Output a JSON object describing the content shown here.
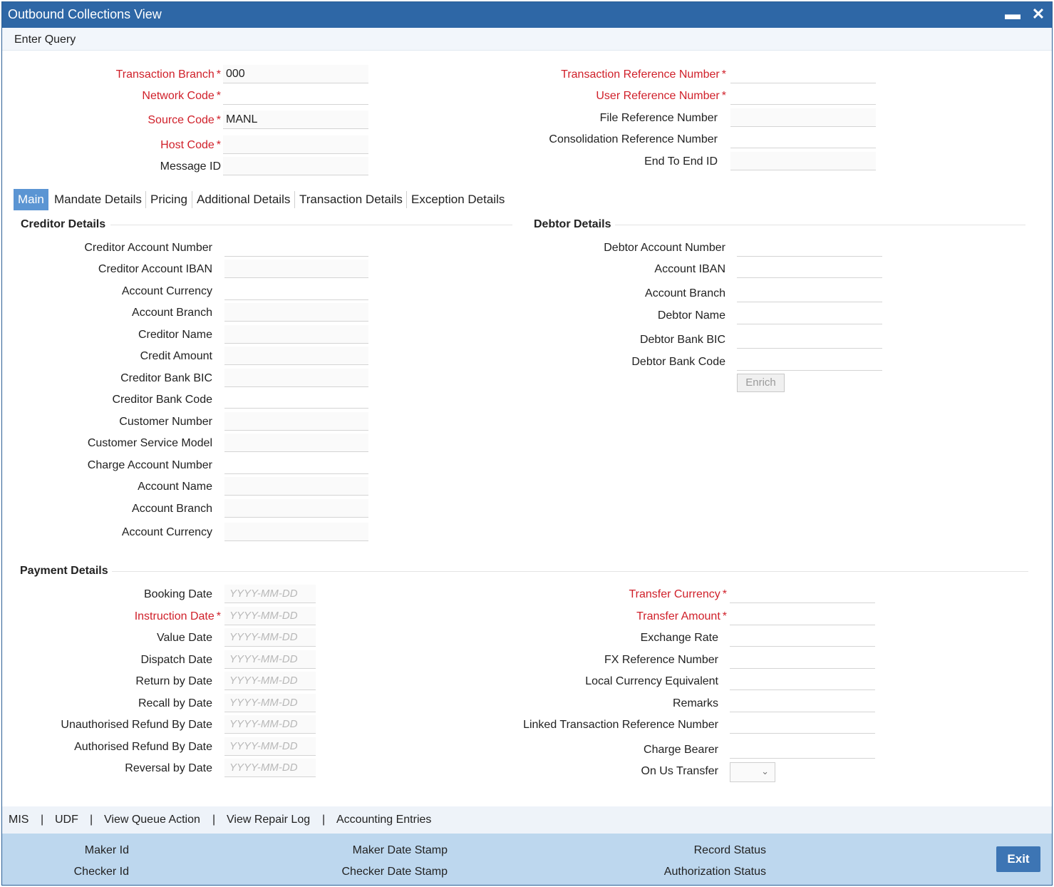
{
  "window": {
    "title": "Outbound Collections View"
  },
  "menu": {
    "enter_query": "Enter Query"
  },
  "header": {
    "transaction_branch": {
      "label": "Transaction Branch",
      "value": "000"
    },
    "network_code": {
      "label": "Network Code",
      "value": ""
    },
    "source_code": {
      "label": "Source Code",
      "value": "MANL"
    },
    "host_code": {
      "label": "Host Code",
      "value": ""
    },
    "message_id": {
      "label": "Message ID",
      "value": ""
    },
    "transaction_reference_number": {
      "label": "Transaction Reference Number",
      "value": ""
    },
    "user_reference_number": {
      "label": "User Reference Number",
      "value": ""
    },
    "file_reference_number": {
      "label": "File Reference Number",
      "value": ""
    },
    "consolidation_reference_number": {
      "label": "Consolidation Reference Number",
      "value": ""
    },
    "end_to_end_id": {
      "label": "End To End ID",
      "value": ""
    }
  },
  "tabs": [
    "Main",
    "Mandate Details",
    "Pricing",
    "Additional Details",
    "Transaction Details",
    "Exception Details"
  ],
  "creditor": {
    "title": "Creditor Details",
    "fields": [
      "Creditor Account Number",
      "Creditor Account IBAN",
      "Account Currency",
      "Account Branch",
      "Creditor Name",
      "Credit Amount",
      "Creditor Bank BIC",
      "Creditor Bank Code",
      "Customer Number",
      "Customer Service Model",
      "Charge Account Number",
      "Account Name",
      "Account Branch",
      "Account Currency"
    ]
  },
  "debtor": {
    "title": "Debtor Details",
    "fields": [
      "Debtor Account Number",
      "Account IBAN",
      "Account Branch",
      "Debtor Name",
      "Debtor Bank BIC",
      "Debtor Bank Code"
    ],
    "enrich_label": "Enrich"
  },
  "payment": {
    "title": "Payment Details",
    "date_placeholder": "YYYY-MM-DD",
    "dates": [
      "Booking Date",
      "Instruction Date",
      "Value Date",
      "Dispatch Date",
      "Return by Date",
      "Recall by Date",
      "Unauthorised Refund By Date",
      "Authorised Refund By Date",
      "Reversal by Date"
    ],
    "right_fields": [
      "Transfer Currency",
      "Transfer Amount",
      "Exchange Rate",
      "FX Reference Number",
      "Local Currency Equivalent",
      "Remarks",
      "Linked Transaction Reference Number",
      "Charge Bearer"
    ],
    "on_us_transfer": "On Us Transfer"
  },
  "links": [
    "MIS",
    "UDF",
    "View Queue Action",
    "View Repair Log",
    "Accounting Entries"
  ],
  "link_separator": "|",
  "footer": {
    "maker_id": "Maker Id",
    "checker_id": "Checker Id",
    "maker_date_stamp": "Maker Date Stamp",
    "checker_date_stamp": "Checker Date Stamp",
    "record_status": "Record Status",
    "authorization_status": "Authorization Status",
    "exit_label": "Exit"
  },
  "required_marker": "*",
  "icons": {
    "minimize": "minimize-icon",
    "close": "close-icon",
    "dropdown": "chevron-down-icon"
  },
  "colors": {
    "titlebar": "#2e67a6",
    "required": "#d0202a",
    "active_tab": "#5b95d3",
    "footer": "#bdd7ee",
    "exit_button": "#3d75b4"
  }
}
